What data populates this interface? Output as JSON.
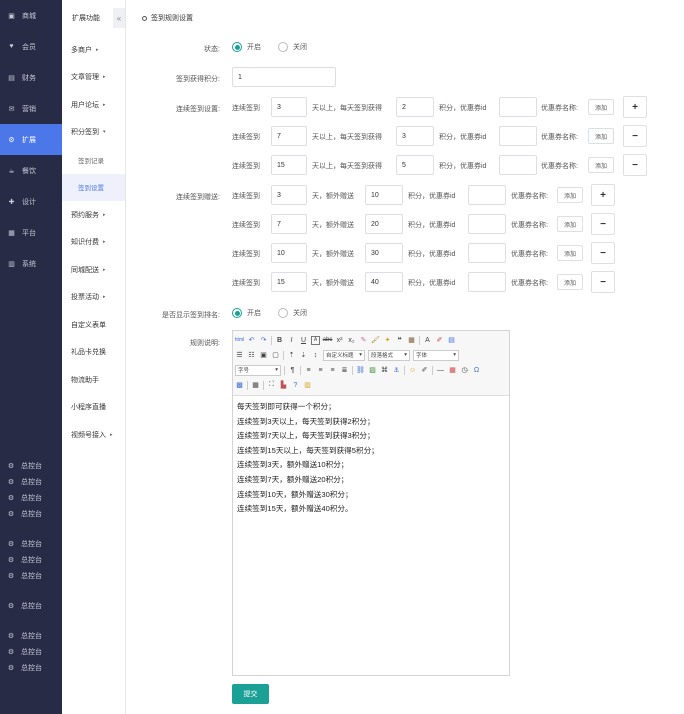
{
  "sidebar": {
    "items": [
      {
        "label": "商城",
        "icon": "store-icon"
      },
      {
        "label": "会员",
        "icon": "member-icon"
      },
      {
        "label": "财务",
        "icon": "finance-icon"
      },
      {
        "label": "营销",
        "icon": "marketing-icon"
      },
      {
        "label": "扩展",
        "icon": "extend-icon",
        "active": true
      },
      {
        "label": "餐饮",
        "icon": "food-icon"
      },
      {
        "label": "设计",
        "icon": "design-icon"
      },
      {
        "label": "平台",
        "icon": "platform-icon"
      },
      {
        "label": "系统",
        "icon": "system-icon"
      }
    ],
    "bottom_label": "总控台"
  },
  "submenu": {
    "title": "扩展功能",
    "collapse": "«",
    "items": [
      {
        "label": "多商户",
        "arrow": "▸"
      },
      {
        "label": "文章管理",
        "arrow": "▸"
      },
      {
        "label": "用户论坛",
        "arrow": "▸"
      },
      {
        "label": "积分签到",
        "arrow": "▾"
      }
    ],
    "subs": [
      {
        "label": "签到记录"
      },
      {
        "label": "签到设置",
        "active": true
      }
    ],
    "items2": [
      {
        "label": "预约服务",
        "arrow": "▸"
      },
      {
        "label": "知识付费",
        "arrow": "▸"
      },
      {
        "label": "同城配送",
        "arrow": "▸"
      },
      {
        "label": "投票活动",
        "arrow": "▸"
      },
      {
        "label": "自定义表单",
        "arrow": ""
      },
      {
        "label": "礼品卡兑换",
        "arrow": ""
      },
      {
        "label": "物流助手",
        "arrow": ""
      },
      {
        "label": "小程序直播",
        "arrow": ""
      },
      {
        "label": "视频号接入",
        "arrow": "▸"
      }
    ]
  },
  "page": {
    "title": "签到规则设置",
    "status_label": "状态:",
    "on": "开启",
    "off": "关闭",
    "points_label": "签到获得积分:",
    "points_value": "1",
    "cont_label": "连续签到设置:",
    "gift_label": "连续签到赠送:",
    "rank_label": "是否显示签到排名:",
    "rule_label": "规则说明:",
    "t_cont": "连续签到",
    "t_days_get": "天以上，每天签到获得",
    "t_points_coupon": "积分，优惠券id",
    "t_coupon_name": "优惠券名称:",
    "t_add": "添加",
    "t_days_extra": "天，额外赠送",
    "plus": "+",
    "minus": "−",
    "submit": "提交"
  },
  "cont_rows": [
    {
      "days": "3",
      "points": "2",
      "btn": "plus"
    },
    {
      "days": "7",
      "points": "3",
      "btn": "minus"
    },
    {
      "days": "15",
      "points": "5",
      "btn": "minus"
    }
  ],
  "gift_rows": [
    {
      "days": "3",
      "points": "10",
      "btn": "plus"
    },
    {
      "days": "7",
      "points": "20",
      "btn": "minus"
    },
    {
      "days": "10",
      "points": "30",
      "btn": "minus"
    },
    {
      "days": "15",
      "points": "40",
      "btn": "minus"
    }
  ],
  "editor": {
    "sel_heading": "自定义标题",
    "sel_para": "段落格式",
    "sel_font": "字体",
    "sel_size": "字号",
    "lines": [
      "每天签到即可获得一个积分；",
      "连续签到3天以上，每天签到获得2积分；",
      "连续签到7天以上，每天签到获得3积分；",
      "连续签到15天以上，每天签到获得5积分；",
      "连续签到3天，额外赠送10积分；",
      "连续签到7天，额外赠送20积分；",
      "连续签到10天，额外赠送30积分；",
      "连续签到15天，额外赠送40积分。"
    ]
  }
}
